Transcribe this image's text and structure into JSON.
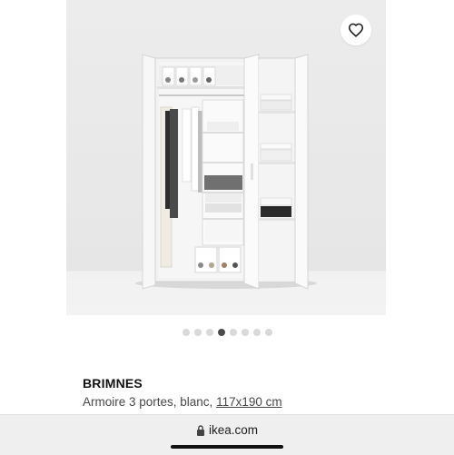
{
  "product": {
    "name": "BRIMNES",
    "description": "Armoire 3 portes, blanc, ",
    "dimensions": "117x190 cm"
  },
  "gallery": {
    "image": "wardrobe-photo",
    "total_images": 8,
    "active_index": 4,
    "favorite_icon": "heart-outline-icon"
  },
  "browser": {
    "url": "ikea.com",
    "lock_icon": "lock-icon"
  }
}
